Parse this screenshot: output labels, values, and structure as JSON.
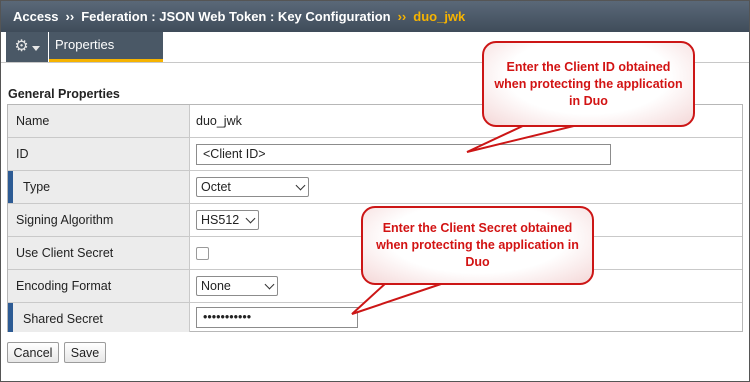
{
  "breadcrumb": {
    "items": [
      "Access",
      "Federation : JSON Web Token : Key Configuration"
    ],
    "separator": "››",
    "current": "duo_jwk"
  },
  "toolbar": {
    "gear_icon": "gear-icon",
    "tab_label": "Properties"
  },
  "section": {
    "title": "General Properties"
  },
  "rows": {
    "name": {
      "label": "Name",
      "value": "duo_jwk"
    },
    "id": {
      "label": "ID",
      "value": "<Client ID>"
    },
    "type": {
      "label": "Type",
      "value": "Octet"
    },
    "signing": {
      "label": "Signing Algorithm",
      "value": "HS512"
    },
    "use_secret": {
      "label": "Use Client Secret",
      "checked": false
    },
    "encoding": {
      "label": "Encoding Format",
      "value": "None"
    },
    "shared_secret": {
      "label": "Shared Secret",
      "value": "•••••••••••"
    }
  },
  "buttons": {
    "cancel": "Cancel",
    "save": "Save"
  },
  "callouts": {
    "client_id": "Enter the Client ID obtained when protecting the application in Duo",
    "client_secret": "Enter the Client Secret obtained when protecting the application in Duo"
  },
  "colors": {
    "header": "#4a5866",
    "accent": "#f6b300",
    "required_marker": "#2d5b94",
    "callout": "#d21313"
  }
}
